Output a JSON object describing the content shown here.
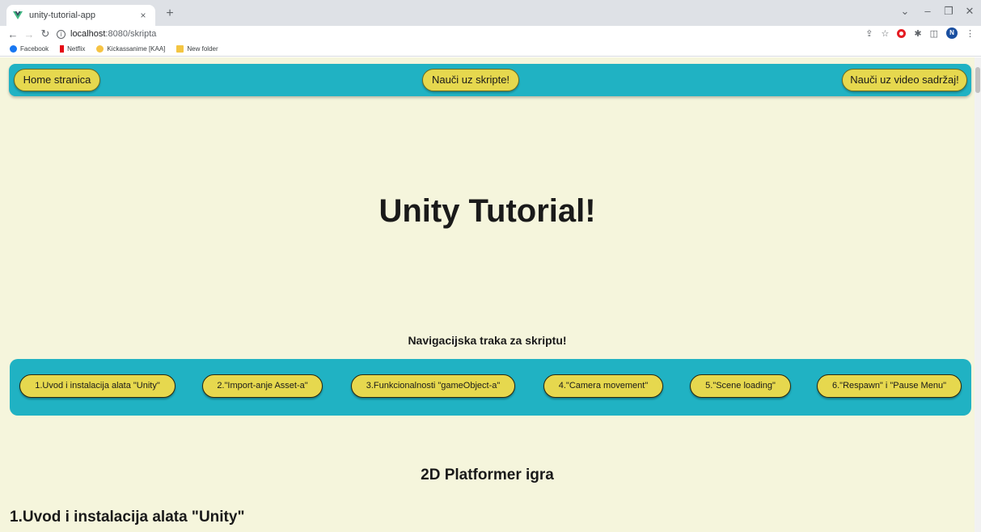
{
  "browser": {
    "tab_title": "unity-tutorial-app",
    "tab_close": "×",
    "new_tab": "+",
    "win_min": "–",
    "win_restore": "❐",
    "win_close": "✕",
    "win_menu": "⌄",
    "url_host": "localhost",
    "url_path": ":8080/skripta",
    "bookmarks": [
      "Facebook",
      "Netflix",
      "Kickassanime [KAA]",
      "New folder"
    ],
    "profile_initial": "N"
  },
  "topnav": {
    "home": "Home stranica",
    "scripts": "Nauči uz skripte!",
    "video": "Nauči uz video sadržaj!"
  },
  "hero": {
    "title": "Unity Tutorial!"
  },
  "subnav": {
    "title": "Navigacijska traka za skriptu!",
    "items": [
      "1.Uvod i instalacija alata \"Unity\"",
      "2.\"Import-anje Asset-a\"",
      "3.Funkcionalnosti \"gameObject-a\"",
      "4.\"Camera movement\"",
      "5.\"Scene loading\"",
      "6.\"Respawn\" i \"Pause Menu\""
    ]
  },
  "content": {
    "section_title": "2D Platformer igra",
    "chapter_title": "1.Uvod i instalacija alata \"Unity\""
  },
  "colors": {
    "page_bg": "#f5f5dc",
    "nav_bg": "#20b2c3",
    "button_bg": "#e6d84e"
  }
}
